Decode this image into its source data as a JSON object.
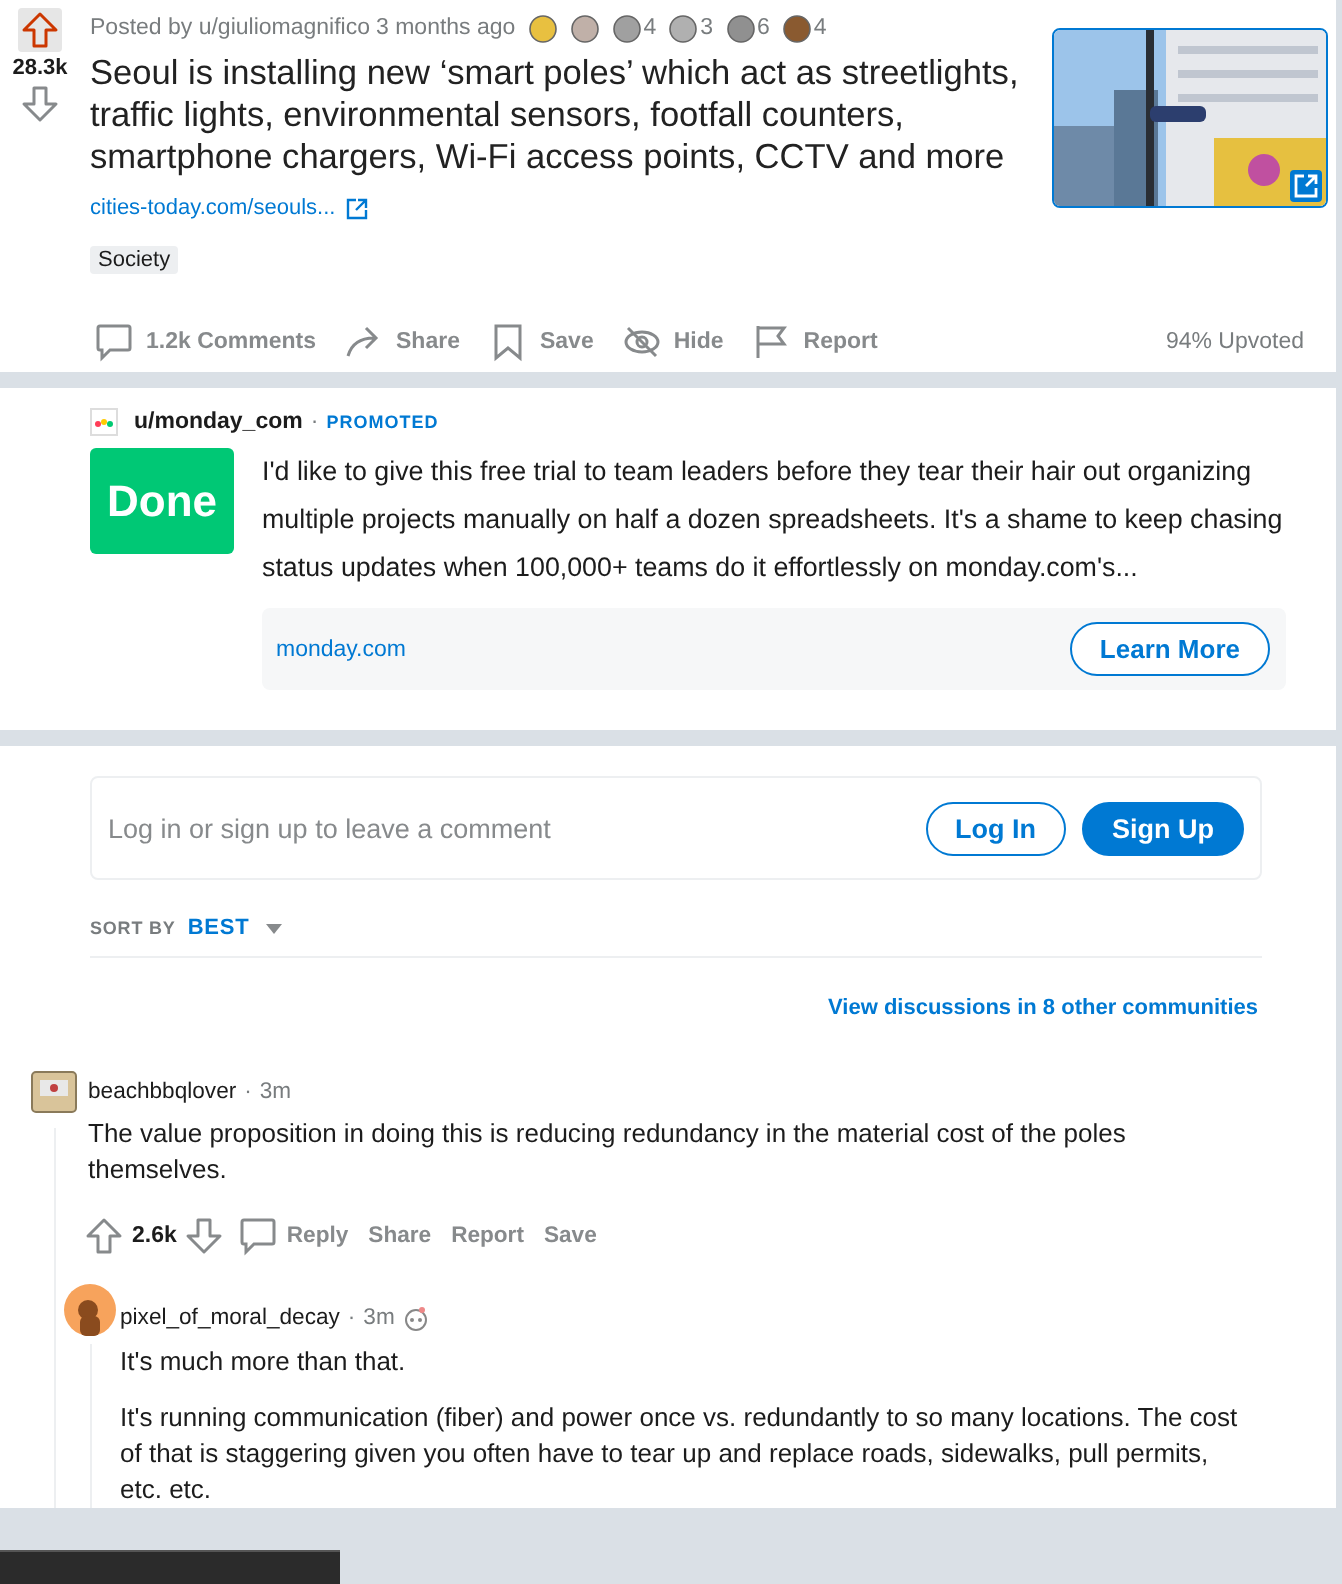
{
  "post": {
    "score": "28.3k",
    "posted_by": "Posted by u/giuliomagnifico",
    "time": "3 months ago",
    "awards": [
      {
        "counted": false
      },
      {
        "counted": false
      },
      {
        "counted": true,
        "count": "4"
      },
      {
        "counted": true,
        "count": "3"
      },
      {
        "counted": true,
        "count": "6"
      },
      {
        "counted": true,
        "count": "4"
      }
    ],
    "title": "Seoul is installing new ‘smart poles’ which act as streetlights, traffic lights, environmental sensors, footfall counters, smartphone chargers, Wi-Fi access points, CCTV and more",
    "link": "cities-today.com/seouls...",
    "flair": "Society",
    "actions": [
      {
        "kind": "comments",
        "label": "1.2k Comments"
      },
      {
        "kind": "share",
        "label": "Share"
      },
      {
        "kind": "save",
        "label": "Save"
      },
      {
        "kind": "hide",
        "label": "Hide"
      },
      {
        "kind": "report",
        "label": "Report"
      }
    ],
    "upvoted": "94% Upvoted"
  },
  "ad": {
    "user": "u/monday_com",
    "separator": "·",
    "promoted": "PROMOTED",
    "logo_text": "Done",
    "body": "I'd like to give this free trial to team leaders before they tear their hair out organizing multiple projects manually on half a dozen spreadsheets. It's a shame to keep chasing status updates when 100,000+ teams do it effortlessly on monday.com's...",
    "domain": "monday.com",
    "button": "Learn More"
  },
  "comment_box": {
    "placeholder": "Log in or sign up to leave a comment",
    "buttons": [
      {
        "kind": "outline",
        "label": "Log In"
      },
      {
        "kind": "filled",
        "label": "Sign Up"
      }
    ]
  },
  "sort": {
    "label": "SORT BY",
    "value": "BEST"
  },
  "other_discussions": "View discussions in 8 other communities",
  "comments": [
    {
      "author": "beachbbqlover",
      "separator": "·",
      "time": "3m",
      "paragraphs": [
        "The value proposition in doing this is reducing redundancy in the material cost of the poles themselves."
      ],
      "score": "2.6k",
      "actions": [
        "Reply",
        "Share",
        "Report",
        "Save"
      ],
      "children": [
        {
          "author": "pixel_of_moral_decay",
          "separator": "·",
          "time": "3m",
          "has_badge": true,
          "paragraphs": [
            "It's much more than that.",
            "It's running communication (fiber) and power once vs. redundantly to so many locations. The cost of that is staggering given you often have to tear up and replace roads, sidewalks, pull permits, etc. etc."
          ]
        }
      ]
    }
  ]
}
